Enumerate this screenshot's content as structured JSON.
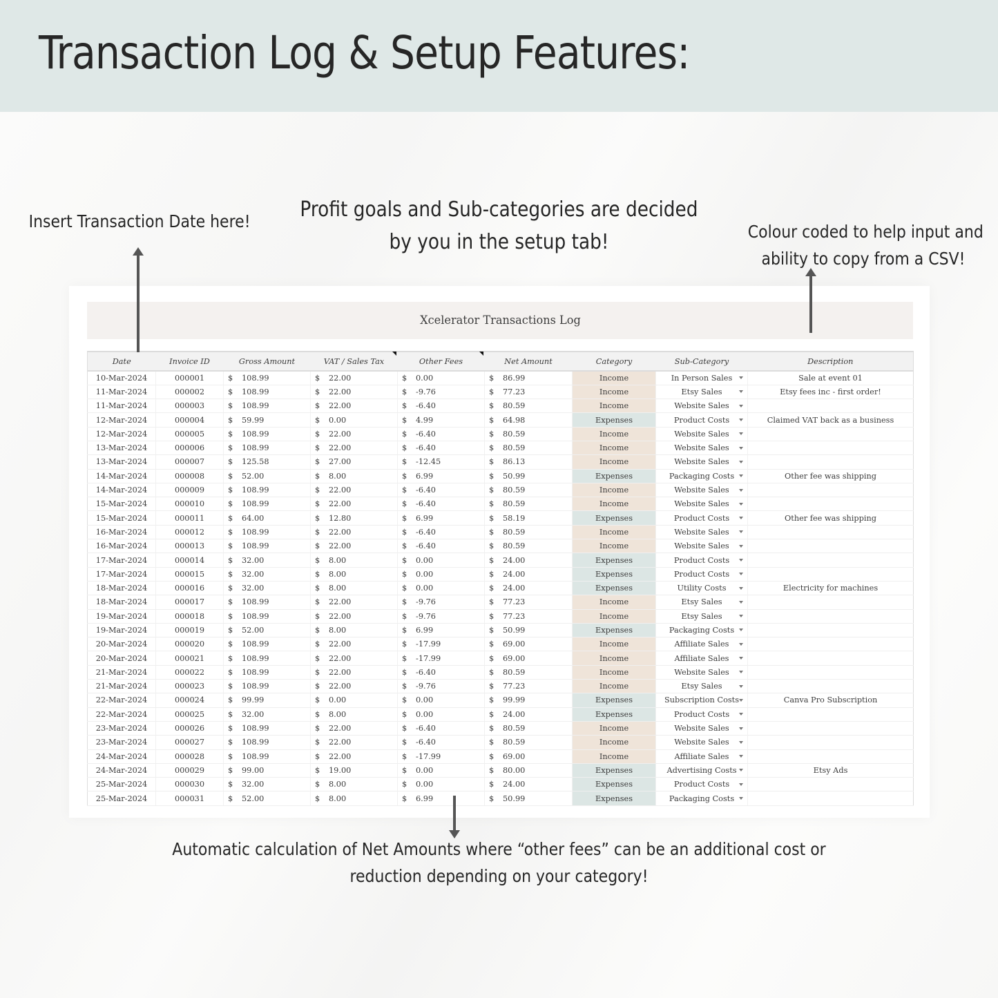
{
  "banner": {
    "title": "Transaction Log & Setup Features:"
  },
  "notes": {
    "date": "Insert Transaction Date here!",
    "setup_line1": "Profit goals and Sub-categories are decided",
    "setup_line2": "by you in the setup tab!",
    "colour_line1": "Colour coded to help input and",
    "colour_line2": "ability to copy from a CSV!",
    "net_line1": "Automatic calculation of Net Amounts where “other fees” can be an additional cost or",
    "net_line2": "reduction depending on your category!"
  },
  "colors": {
    "banner": "#dfe8e7",
    "income": "#efe4d9",
    "expenses": "#dce6e4",
    "sheet_title_bg": "#f4f1ef"
  },
  "sheet": {
    "title": "Xcelerator Transactions Log",
    "currency_symbol": "$",
    "columns": [
      "Date",
      "Invoice ID",
      "Gross Amount",
      "VAT / Sales Tax",
      "Other Fees",
      "Net Amount",
      "Category",
      "Sub-Category",
      "Description"
    ],
    "rows": [
      {
        "date": "10-Mar-2024",
        "invoice": "000001",
        "gross": "108.99",
        "vat": "22.00",
        "fees": "0.00",
        "net": "86.99",
        "category": "Income",
        "subcategory": "In Person Sales",
        "description": "Sale at event 01"
      },
      {
        "date": "11-Mar-2024",
        "invoice": "000002",
        "gross": "108.99",
        "vat": "22.00",
        "fees": "-9.76",
        "net": "77.23",
        "category": "Income",
        "subcategory": "Etsy Sales",
        "description": "Etsy fees inc - first order!"
      },
      {
        "date": "11-Mar-2024",
        "invoice": "000003",
        "gross": "108.99",
        "vat": "22.00",
        "fees": "-6.40",
        "net": "80.59",
        "category": "Income",
        "subcategory": "Website Sales",
        "description": ""
      },
      {
        "date": "12-Mar-2024",
        "invoice": "000004",
        "gross": "59.99",
        "vat": "0.00",
        "fees": "4.99",
        "net": "64.98",
        "category": "Expenses",
        "subcategory": "Product Costs",
        "description": "Claimed VAT back as a business"
      },
      {
        "date": "12-Mar-2024",
        "invoice": "000005",
        "gross": "108.99",
        "vat": "22.00",
        "fees": "-6.40",
        "net": "80.59",
        "category": "Income",
        "subcategory": "Website Sales",
        "description": ""
      },
      {
        "date": "13-Mar-2024",
        "invoice": "000006",
        "gross": "108.99",
        "vat": "22.00",
        "fees": "-6.40",
        "net": "80.59",
        "category": "Income",
        "subcategory": "Website Sales",
        "description": ""
      },
      {
        "date": "13-Mar-2024",
        "invoice": "000007",
        "gross": "125.58",
        "vat": "27.00",
        "fees": "-12.45",
        "net": "86.13",
        "category": "Income",
        "subcategory": "Website Sales",
        "description": ""
      },
      {
        "date": "14-Mar-2024",
        "invoice": "000008",
        "gross": "52.00",
        "vat": "8.00",
        "fees": "6.99",
        "net": "50.99",
        "category": "Expenses",
        "subcategory": "Packaging Costs",
        "description": "Other fee was shipping"
      },
      {
        "date": "14-Mar-2024",
        "invoice": "000009",
        "gross": "108.99",
        "vat": "22.00",
        "fees": "-6.40",
        "net": "80.59",
        "category": "Income",
        "subcategory": "Website Sales",
        "description": ""
      },
      {
        "date": "15-Mar-2024",
        "invoice": "000010",
        "gross": "108.99",
        "vat": "22.00",
        "fees": "-6.40",
        "net": "80.59",
        "category": "Income",
        "subcategory": "Website Sales",
        "description": ""
      },
      {
        "date": "15-Mar-2024",
        "invoice": "000011",
        "gross": "64.00",
        "vat": "12.80",
        "fees": "6.99",
        "net": "58.19",
        "category": "Expenses",
        "subcategory": "Product Costs",
        "description": "Other fee was shipping"
      },
      {
        "date": "16-Mar-2024",
        "invoice": "000012",
        "gross": "108.99",
        "vat": "22.00",
        "fees": "-6.40",
        "net": "80.59",
        "category": "Income",
        "subcategory": "Website Sales",
        "description": ""
      },
      {
        "date": "16-Mar-2024",
        "invoice": "000013",
        "gross": "108.99",
        "vat": "22.00",
        "fees": "-6.40",
        "net": "80.59",
        "category": "Income",
        "subcategory": "Website Sales",
        "description": ""
      },
      {
        "date": "17-Mar-2024",
        "invoice": "000014",
        "gross": "32.00",
        "vat": "8.00",
        "fees": "0.00",
        "net": "24.00",
        "category": "Expenses",
        "subcategory": "Product Costs",
        "description": ""
      },
      {
        "date": "17-Mar-2024",
        "invoice": "000015",
        "gross": "32.00",
        "vat": "8.00",
        "fees": "0.00",
        "net": "24.00",
        "category": "Expenses",
        "subcategory": "Product Costs",
        "description": ""
      },
      {
        "date": "18-Mar-2024",
        "invoice": "000016",
        "gross": "32.00",
        "vat": "8.00",
        "fees": "0.00",
        "net": "24.00",
        "category": "Expenses",
        "subcategory": "Utility Costs",
        "description": "Electricity for machines"
      },
      {
        "date": "18-Mar-2024",
        "invoice": "000017",
        "gross": "108.99",
        "vat": "22.00",
        "fees": "-9.76",
        "net": "77.23",
        "category": "Income",
        "subcategory": "Etsy Sales",
        "description": ""
      },
      {
        "date": "19-Mar-2024",
        "invoice": "000018",
        "gross": "108.99",
        "vat": "22.00",
        "fees": "-9.76",
        "net": "77.23",
        "category": "Income",
        "subcategory": "Etsy Sales",
        "description": ""
      },
      {
        "date": "19-Mar-2024",
        "invoice": "000019",
        "gross": "52.00",
        "vat": "8.00",
        "fees": "6.99",
        "net": "50.99",
        "category": "Expenses",
        "subcategory": "Packaging Costs",
        "description": ""
      },
      {
        "date": "20-Mar-2024",
        "invoice": "000020",
        "gross": "108.99",
        "vat": "22.00",
        "fees": "-17.99",
        "net": "69.00",
        "category": "Income",
        "subcategory": "Affiliate Sales",
        "description": ""
      },
      {
        "date": "20-Mar-2024",
        "invoice": "000021",
        "gross": "108.99",
        "vat": "22.00",
        "fees": "-17.99",
        "net": "69.00",
        "category": "Income",
        "subcategory": "Affiliate Sales",
        "description": ""
      },
      {
        "date": "21-Mar-2024",
        "invoice": "000022",
        "gross": "108.99",
        "vat": "22.00",
        "fees": "-6.40",
        "net": "80.59",
        "category": "Income",
        "subcategory": "Website Sales",
        "description": ""
      },
      {
        "date": "21-Mar-2024",
        "invoice": "000023",
        "gross": "108.99",
        "vat": "22.00",
        "fees": "-9.76",
        "net": "77.23",
        "category": "Income",
        "subcategory": "Etsy Sales",
        "description": ""
      },
      {
        "date": "22-Mar-2024",
        "invoice": "000024",
        "gross": "99.99",
        "vat": "0.00",
        "fees": "0.00",
        "net": "99.99",
        "category": "Expenses",
        "subcategory": "Subscription Costs",
        "description": "Canva Pro Subscription"
      },
      {
        "date": "22-Mar-2024",
        "invoice": "000025",
        "gross": "32.00",
        "vat": "8.00",
        "fees": "0.00",
        "net": "24.00",
        "category": "Expenses",
        "subcategory": "Product Costs",
        "description": ""
      },
      {
        "date": "23-Mar-2024",
        "invoice": "000026",
        "gross": "108.99",
        "vat": "22.00",
        "fees": "-6.40",
        "net": "80.59",
        "category": "Income",
        "subcategory": "Website Sales",
        "description": ""
      },
      {
        "date": "23-Mar-2024",
        "invoice": "000027",
        "gross": "108.99",
        "vat": "22.00",
        "fees": "-6.40",
        "net": "80.59",
        "category": "Income",
        "subcategory": "Website Sales",
        "description": ""
      },
      {
        "date": "24-Mar-2024",
        "invoice": "000028",
        "gross": "108.99",
        "vat": "22.00",
        "fees": "-17.99",
        "net": "69.00",
        "category": "Income",
        "subcategory": "Affiliate Sales",
        "description": ""
      },
      {
        "date": "24-Mar-2024",
        "invoice": "000029",
        "gross": "99.00",
        "vat": "19.00",
        "fees": "0.00",
        "net": "80.00",
        "category": "Expenses",
        "subcategory": "Advertising Costs",
        "description": "Etsy Ads"
      },
      {
        "date": "25-Mar-2024",
        "invoice": "000030",
        "gross": "32.00",
        "vat": "8.00",
        "fees": "0.00",
        "net": "24.00",
        "category": "Expenses",
        "subcategory": "Product Costs",
        "description": ""
      },
      {
        "date": "25-Mar-2024",
        "invoice": "000031",
        "gross": "52.00",
        "vat": "8.00",
        "fees": "6.99",
        "net": "50.99",
        "category": "Expenses",
        "subcategory": "Packaging Costs",
        "description": ""
      }
    ]
  }
}
